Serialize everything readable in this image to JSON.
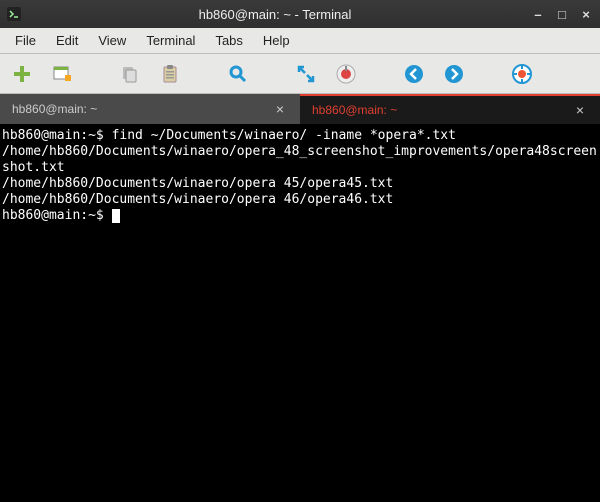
{
  "titlebar": {
    "title": "hb860@main: ~ - Terminal",
    "minimize": "–",
    "maximize": "□",
    "close": "×"
  },
  "menu": {
    "file": "File",
    "edit": "Edit",
    "view": "View",
    "terminal": "Terminal",
    "tabs": "Tabs",
    "help": "Help"
  },
  "tabs": [
    {
      "label": "hb860@main: ~",
      "active": false,
      "close": "×"
    },
    {
      "label": "hb860@main: ~",
      "active": true,
      "close": "×"
    }
  ],
  "terminal": {
    "lines": [
      "hb860@main:~$ find ~/Documents/winaero/ -iname *opera*.txt",
      "/home/hb860/Documents/winaero/opera_48_screenshot_improvements/opera48screenshot.txt",
      "/home/hb860/Documents/winaero/opera 45/opera45.txt",
      "/home/hb860/Documents/winaero/opera 46/opera46.txt",
      "hb860@main:~$ "
    ],
    "prompt": "hb860@main:~$",
    "command": "find ~/Documents/winaero/ -iname *opera*.txt"
  }
}
